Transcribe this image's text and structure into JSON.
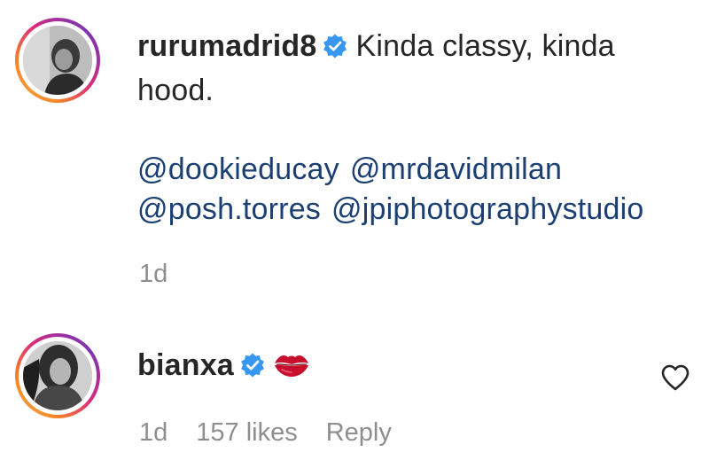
{
  "post": {
    "author": {
      "username": "rurumadrid8",
      "verified": true
    },
    "caption_line1": "Kinda classy, kinda",
    "caption_line2": "hood.",
    "mentions_line1": [
      "@dookieducay",
      "@mrdavidmilan"
    ],
    "mentions_line2": [
      "@posh.torres",
      "@jpiphotographystudio"
    ],
    "timestamp": "1d"
  },
  "comment": {
    "author": {
      "username": "bianxa",
      "verified": true
    },
    "emoji": "kiss-mark-emoji",
    "timestamp": "1d",
    "likes": "157 likes",
    "reply_label": "Reply",
    "like_icon": "heart-outline-icon"
  },
  "colors": {
    "verified_blue": "#3897f0",
    "mention": "#1b3f73",
    "meta_gray": "#8e8e8e",
    "text": "#262626",
    "kiss_red": "#c8102e"
  }
}
